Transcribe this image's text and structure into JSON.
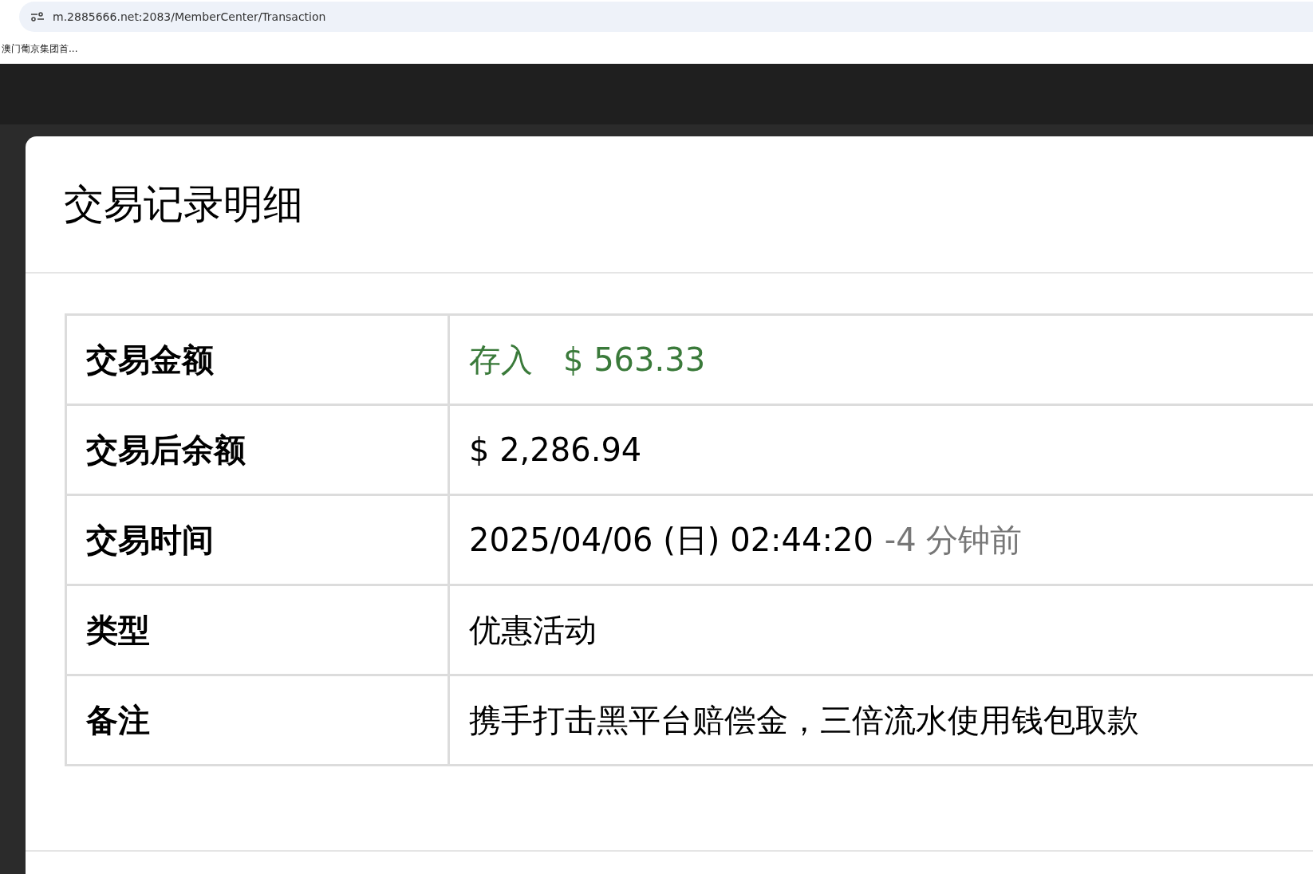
{
  "browser": {
    "url": "m.2885666.net:2083/MemberCenter/Transaction",
    "bookmarks": [
      "澳门葡京集团首..."
    ]
  },
  "dialog": {
    "title": "交易记录明细",
    "rows": [
      {
        "label": "交易金额",
        "kind": "amount",
        "type": "存入",
        "value": "$ 563.33"
      },
      {
        "label": "交易后余额",
        "kind": "plain",
        "value": "$ 2,286.94"
      },
      {
        "label": "交易时间",
        "kind": "time",
        "value": "2025/04/06 (日) 02:44:20",
        "ago": "-4 分钟前"
      },
      {
        "label": "类型",
        "kind": "plain",
        "value": "优惠活动"
      },
      {
        "label": "备注",
        "kind": "plain",
        "value": "携手打击黑平台赔偿金，三倍流水使用钱包取款"
      }
    ]
  }
}
